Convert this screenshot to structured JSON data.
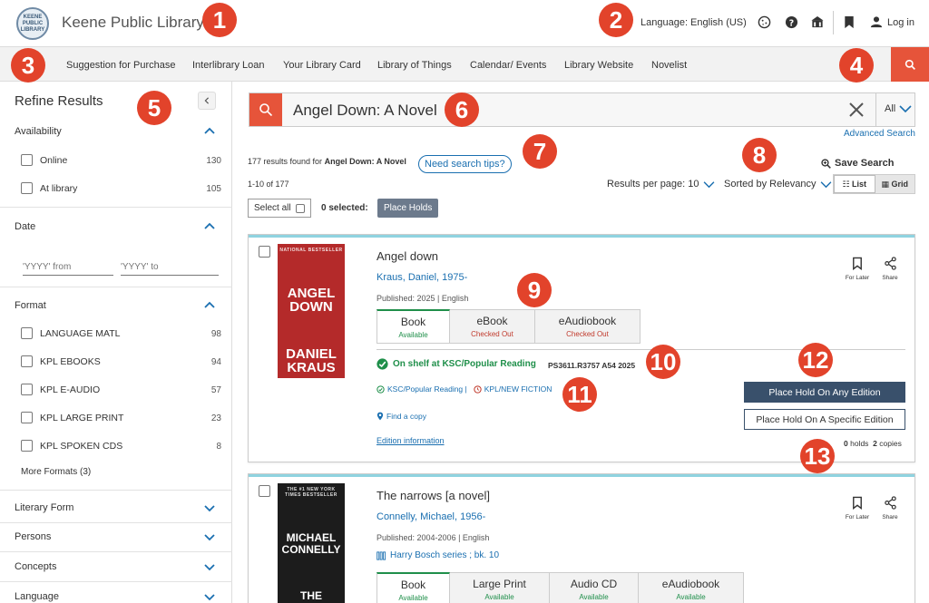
{
  "header": {
    "logo_text": "KEENE PUBLIC LIBRARY",
    "title": "Keene Public Library",
    "language": "Language: English (US)",
    "login": "Log in"
  },
  "nav": {
    "items": [
      "Suggestion for Purchase",
      "Interlibrary Loan",
      "Your Library Card",
      "Library of Things",
      "Calendar/ Events",
      "Library Website",
      "Novelist"
    ]
  },
  "markers": [
    "1",
    "2",
    "3",
    "4",
    "5",
    "6",
    "7",
    "8",
    "9",
    "10",
    "11",
    "12",
    "13"
  ],
  "sidebar": {
    "title": "Refine Results",
    "availability": {
      "label": "Availability",
      "items": [
        {
          "label": "Online",
          "count": "130"
        },
        {
          "label": "At library",
          "count": "105"
        }
      ]
    },
    "date": {
      "label": "Date",
      "from_placeholder": "'YYYY' from",
      "to_placeholder": "'YYYY' to"
    },
    "format": {
      "label": "Format",
      "items": [
        {
          "label": "LANGUAGE MATL",
          "count": "98"
        },
        {
          "label": "KPL EBOOKS",
          "count": "94"
        },
        {
          "label": "KPL E-AUDIO",
          "count": "57"
        },
        {
          "label": "KPL LARGE PRINT",
          "count": "23"
        },
        {
          "label": "KPL SPOKEN CDS",
          "count": "8"
        }
      ],
      "more": "More Formats (3)"
    },
    "collapsed": [
      "Literary Form",
      "Persons",
      "Concepts",
      "Language"
    ]
  },
  "search": {
    "query": "Angel Down: A Novel",
    "scope": "All",
    "advanced": "Advanced Search",
    "results_prefix": "177 results found for",
    "results_query": "Angel Down: A Novel",
    "tips": "Need search tips?",
    "save": "Save Search",
    "range": "1-10 of 177",
    "per_page": "Results per page: 10",
    "sort": "Sorted by Relevancy",
    "view_list": "List",
    "view_grid": "Grid",
    "select_all": "Select all",
    "selected": "0 selected:",
    "place_holds": "Place Holds"
  },
  "results": [
    {
      "title": "Angel down",
      "author": "Kraus, Daniel, 1975-",
      "published": "Published: 2025 | English",
      "cover": {
        "line1": "NATIONAL BESTSELLER",
        "line2": "ANGEL DOWN",
        "line3": "DANIEL KRAUS",
        "color": "#b42a2a"
      },
      "formats": [
        {
          "name": "Book",
          "status": "Available"
        },
        {
          "name": "eBook",
          "status": "Checked Out"
        },
        {
          "name": "eAudiobook",
          "status": "Checked Out"
        }
      ],
      "shelf": "On shelf at KSC/Popular Reading",
      "call_number": "PS3611.R3757 A54 2025",
      "loc1": "KSC/Popular Reading |",
      "loc2": "KPL/NEW FICTION",
      "find_copy": "Find a copy",
      "edition": "Edition information",
      "for_later": "For Later",
      "share": "Share",
      "hold_any": "Place Hold On Any Edition",
      "hold_specific": "Place Hold On A Specific Edition",
      "holds_count": "0",
      "holds_label": "holds",
      "copies_count": "2",
      "copies_label": "copies"
    },
    {
      "title": "The narrows [a novel]",
      "author": "Connelly, Michael, 1956-",
      "published": "Published: 2004-2006 | English",
      "series": "Harry Bosch series ; bk. 10",
      "cover": {
        "line1": "THE #1 NEW YORK TIMES BESTSELLER",
        "line2": "MICHAEL CONNELLY",
        "line3": "THE NARROWS",
        "color": "#1c1c1c"
      },
      "formats": [
        {
          "name": "Book",
          "status": "Available"
        },
        {
          "name": "Large Print",
          "status": "Available"
        },
        {
          "name": "Audio CD",
          "status": "Available"
        },
        {
          "name": "eAudiobook",
          "status": "Available"
        }
      ],
      "for_later": "For Later",
      "share": "Share"
    }
  ],
  "colors": {
    "accent": "#e6543a",
    "marker": "#e2432b",
    "available": "#1f8f4a",
    "checked_out": "#c0392b",
    "link": "#1a6fb0",
    "hold_button": "#39506b"
  }
}
